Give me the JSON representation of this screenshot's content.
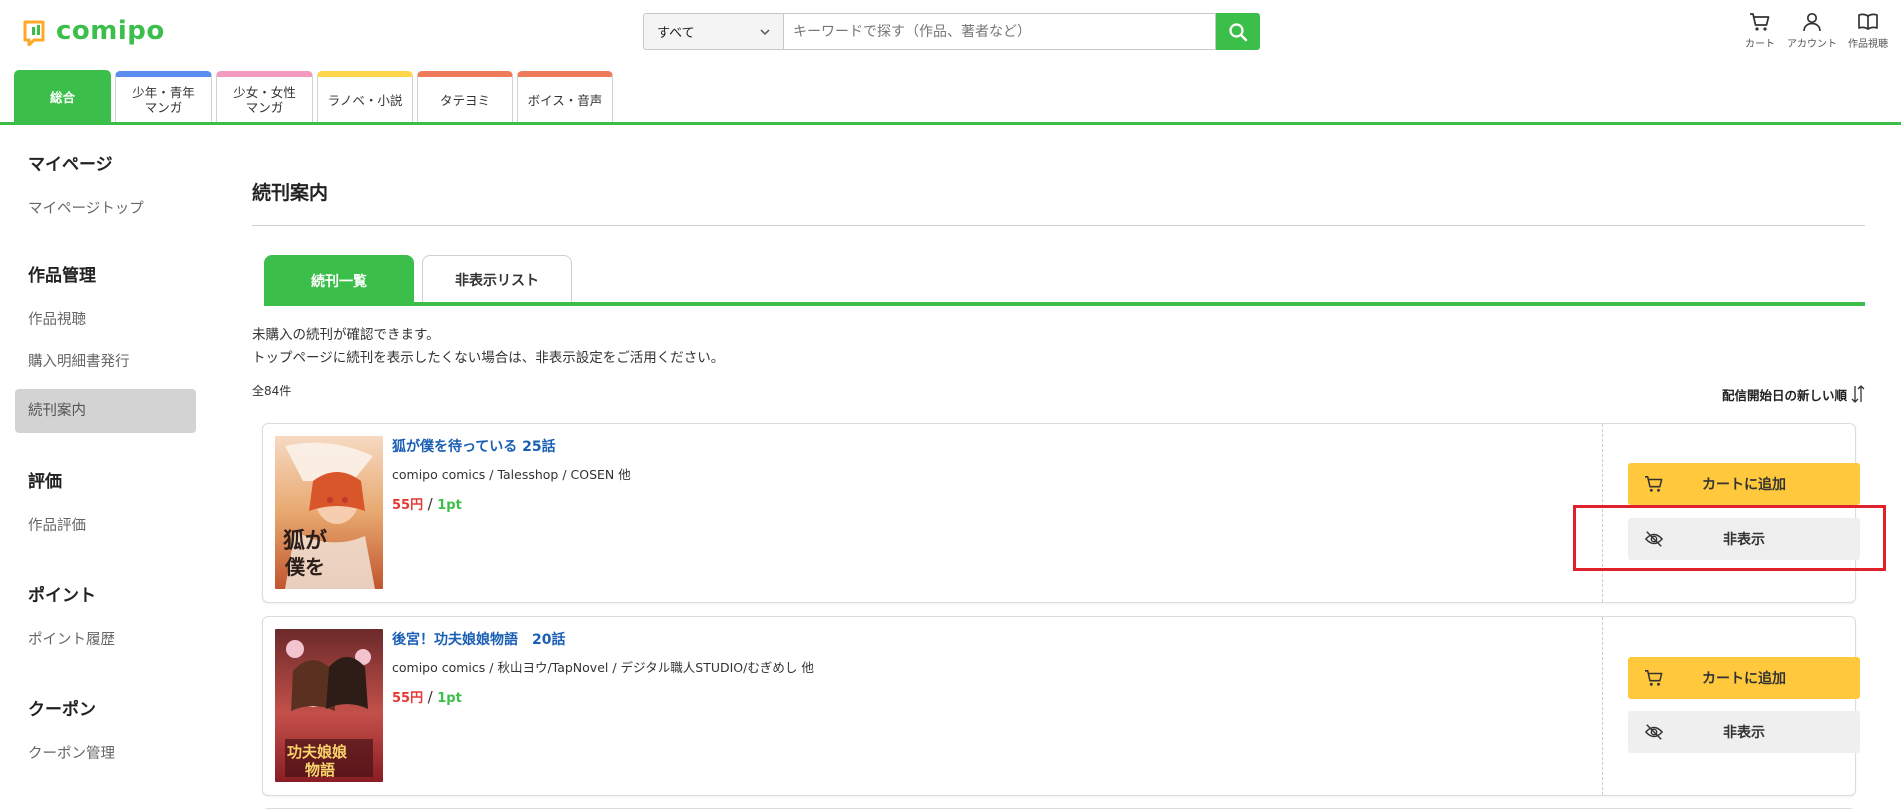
{
  "header": {
    "logo_text": "comipo",
    "search_select": "すべて",
    "search_placeholder": "キーワードで探す（作品、著者など）",
    "icons": [
      {
        "name": "cart-icon",
        "label": "カート"
      },
      {
        "name": "account-icon",
        "label": "アカウント"
      },
      {
        "name": "book-icon",
        "label": "作品視聴"
      }
    ]
  },
  "category_tabs": [
    {
      "label": "総合",
      "active": true,
      "color": "#3cbf4a"
    },
    {
      "label": "少年・青年\nマンガ",
      "color": "#5b8def"
    },
    {
      "label": "少女・女性\nマンガ",
      "color": "#f49ac1"
    },
    {
      "label": "ラノベ・小説",
      "color": "#ffd54a"
    },
    {
      "label": "タテヨミ",
      "color": "#f07b5a"
    },
    {
      "label": "ボイス・音声",
      "color": "#f07b5a"
    }
  ],
  "sidebar": {
    "sections": [
      {
        "head": "マイページ",
        "items": [
          "マイページトップ"
        ]
      },
      {
        "head": "作品管理",
        "items": [
          "作品視聴",
          "購入明細書発行",
          "続刊案内"
        ]
      },
      {
        "head": "評価",
        "items": [
          "作品評価"
        ]
      },
      {
        "head": "ポイント",
        "items": [
          "ポイント履歴"
        ]
      },
      {
        "head": "クーポン",
        "items": [
          "クーポン管理"
        ]
      }
    ],
    "active_item": "続刊案内"
  },
  "main": {
    "title": "続刊案内",
    "tabs": [
      {
        "label": "続刊一覧",
        "active": true
      },
      {
        "label": "非表示リスト",
        "active": false
      }
    ],
    "desc_line1": "未購入の続刊が確認できます。",
    "desc_line2": "トップページに続刊を表示したくない場合は、非表示設定をご活用ください。",
    "count": "全84件",
    "sort_label": "配信開始日の新しい順",
    "items": [
      {
        "title": "狐が僕を待っている 25話",
        "authors": "comipo comics / Talesshop / COSEN 他",
        "price_yen": "55円",
        "price_sep": "/",
        "price_pt": "1pt",
        "cart_label": "カートに追加",
        "hide_label": "非表示"
      },
      {
        "title": "後宮！功夫娘娘物語　20話",
        "authors": "comipo comics / 秋山ヨウ/TapNovel / デジタル職人STUDIO/むぎめし 他",
        "price_yen": "55円",
        "price_sep": "/",
        "price_pt": "1pt",
        "cart_label": "カートに追加",
        "hide_label": "非表示"
      }
    ]
  },
  "colors": {
    "brand_green": "#3cbf4a",
    "cart_yellow": "#ffc83d",
    "title_blue": "#1a5fb4",
    "price_red": "#e53935",
    "highlight_red": "#e0202a"
  }
}
